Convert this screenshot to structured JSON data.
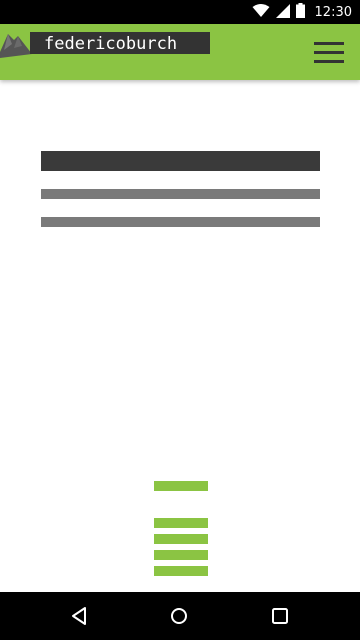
{
  "status_bar": {
    "time": "12:30",
    "icons": [
      "wifi-icon",
      "signal-icon",
      "battery-icon"
    ]
  },
  "header": {
    "logo_text": "federicoburch",
    "menu_icon": "hamburger-menu-icon",
    "background_color": "#8bc443"
  },
  "content": {
    "placeholders": [
      "title-placeholder",
      "text-line-placeholder",
      "text-line-placeholder"
    ]
  },
  "nav_bar": {
    "buttons": [
      "back-icon",
      "home-icon",
      "recents-icon"
    ]
  },
  "colors": {
    "accent": "#8bc443",
    "dark": "#333333",
    "placeholder_dark": "#3a3a3a",
    "placeholder_light": "#7a7a7a"
  }
}
